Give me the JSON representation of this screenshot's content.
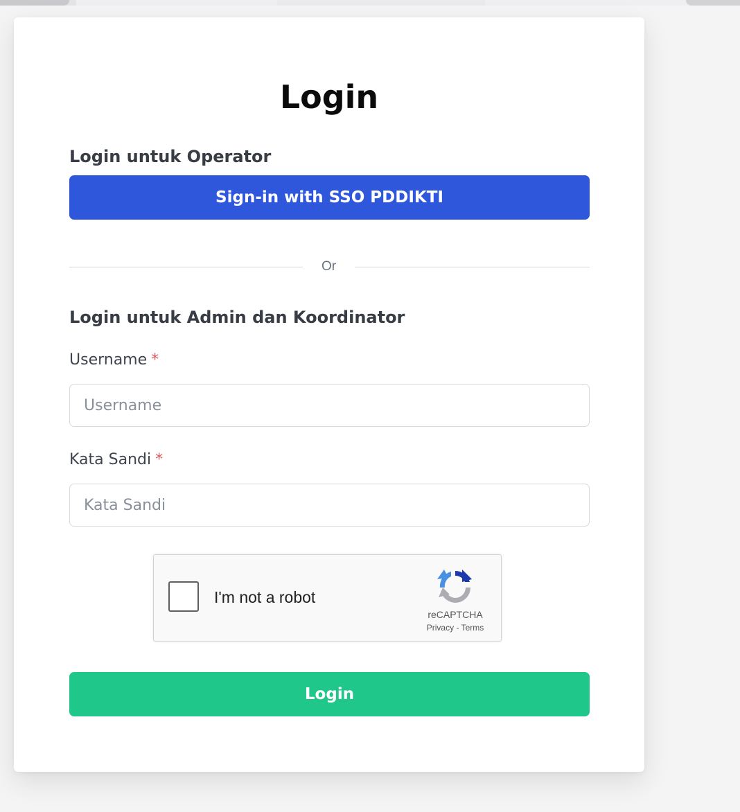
{
  "page": {
    "title": "Login"
  },
  "operator_section": {
    "label": "Login untuk Operator",
    "sso_button_label": "Sign-in with SSO PDDIKTI"
  },
  "divider": {
    "text": "Or"
  },
  "admin_section": {
    "label": "Login untuk Admin dan Koordinator",
    "username": {
      "label": "Username",
      "required_mark": "*",
      "placeholder": "Username",
      "value": ""
    },
    "password": {
      "label": "Kata Sandi",
      "required_mark": "*",
      "placeholder": "Kata Sandi",
      "value": ""
    }
  },
  "captcha": {
    "checkbox_label": "I'm not a robot",
    "checked": false,
    "brand": "reCAPTCHA",
    "privacy_link": "Privacy",
    "separator": "-",
    "terms_link": "Terms",
    "icon": "recaptcha-logo-icon"
  },
  "login_button_label": "Login",
  "colors": {
    "sso_button": "#2f57dc",
    "login_button": "#1fc78a",
    "required_mark": "#e0565b"
  }
}
